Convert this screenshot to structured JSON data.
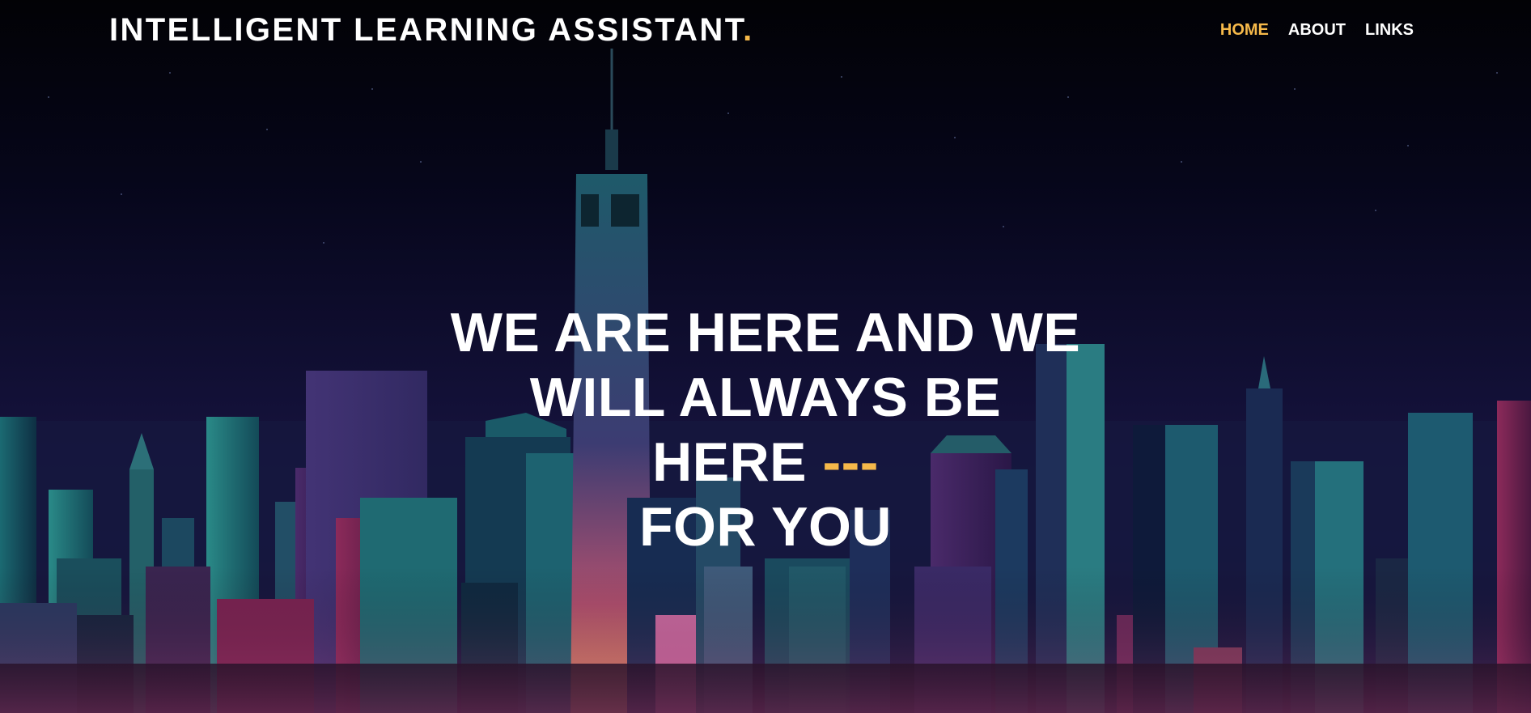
{
  "header": {
    "brand": "INTELLIGENT LEARNING ASSISTANT",
    "brand_dot": "."
  },
  "nav": {
    "items": [
      {
        "label": "HOME",
        "active": true
      },
      {
        "label": "ABOUT",
        "active": false
      },
      {
        "label": "LINKS",
        "active": false
      }
    ]
  },
  "hero": {
    "line1": "WE ARE HERE AND WE",
    "line2": "WILL ALWAYS BE",
    "line3": "HERE",
    "line3_accent": "---",
    "line4": "FOR YOU"
  },
  "colors": {
    "accent": "#f6b94a",
    "text": "#ffffff",
    "background_top": "#03030a",
    "background_mid": "#0f0c2e"
  }
}
